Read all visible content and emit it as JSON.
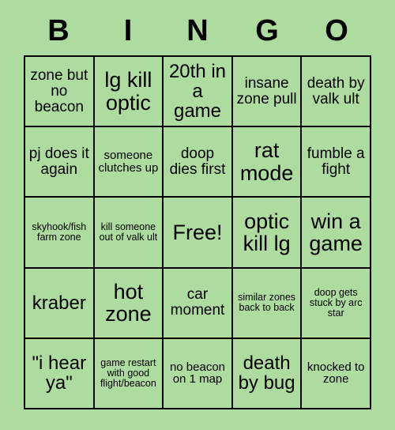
{
  "board": {
    "background_color": "#aedba0",
    "header_letters": [
      "B",
      "I",
      "N",
      "G",
      "O"
    ],
    "cells": [
      {
        "text": "zone but no beacon",
        "size": "md"
      },
      {
        "text": "lg kill optic",
        "size": "xl"
      },
      {
        "text": "20th in a game",
        "size": "lg"
      },
      {
        "text": "insane zone pull",
        "size": "md"
      },
      {
        "text": "death by valk ult",
        "size": "md"
      },
      {
        "text": "pj does it again",
        "size": "md"
      },
      {
        "text": "someone clutches up",
        "size": "sm"
      },
      {
        "text": "doop dies first",
        "size": "md"
      },
      {
        "text": "rat mode",
        "size": "xl"
      },
      {
        "text": "fumble a fight",
        "size": "md"
      },
      {
        "text": "skyhook/fish farm zone",
        "size": "xs"
      },
      {
        "text": "kill someone out of valk ult",
        "size": "xs"
      },
      {
        "text": "Free!",
        "size": "xl"
      },
      {
        "text": "optic kill lg",
        "size": "xl"
      },
      {
        "text": "win a game",
        "size": "xl"
      },
      {
        "text": "kraber",
        "size": "lg"
      },
      {
        "text": "hot zone",
        "size": "xl"
      },
      {
        "text": "car moment",
        "size": "md"
      },
      {
        "text": "similar zones back to back",
        "size": "xs"
      },
      {
        "text": "doop gets stuck by arc star",
        "size": "xs"
      },
      {
        "text": "\"i hear ya\"",
        "size": "lg"
      },
      {
        "text": "game restart with good flight/beacon",
        "size": "xs"
      },
      {
        "text": "no beacon on 1 map",
        "size": "sm"
      },
      {
        "text": "death by bug",
        "size": "lg"
      },
      {
        "text": "knocked to zone",
        "size": "sm"
      }
    ]
  }
}
